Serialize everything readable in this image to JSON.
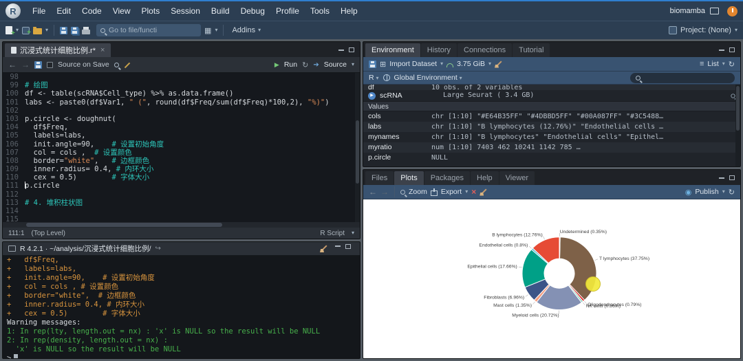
{
  "menubar": {
    "menus": [
      "File",
      "Edit",
      "Code",
      "View",
      "Plots",
      "Session",
      "Build",
      "Debug",
      "Profile",
      "Tools",
      "Help"
    ],
    "user": "biomamba",
    "project_label": "Project: (None)"
  },
  "toolbar": {
    "goto_placeholder": "Go to file/functi",
    "addins_label": "Addins"
  },
  "source": {
    "tab_title": "沉浸式统计细胞比例.r*",
    "source_on_save": "Source on Save",
    "run_label": "Run",
    "source_label": "Source",
    "status_position": "111:1",
    "status_scope": "(Top Level)",
    "status_type": "R Script",
    "cursor_line": 111,
    "code_lines": [
      {
        "n": 98,
        "seg": []
      },
      {
        "n": 99,
        "seg": [
          [
            "com",
            "# 绘图"
          ]
        ]
      },
      {
        "n": 100,
        "seg": [
          [
            "def",
            "df <- table(scRNA$Cell_type) %>% as.data.frame()"
          ]
        ]
      },
      {
        "n": 101,
        "seg": [
          [
            "def",
            "labs <- paste0(df$Var1, "
          ],
          [
            "str",
            "\" (\""
          ],
          [
            "def",
            ", round(df$Freq/sum(df$Freq)*100,2), "
          ],
          [
            "str",
            "\"%)\""
          ],
          [
            "def",
            ")"
          ]
        ]
      },
      {
        "n": 102,
        "seg": []
      },
      {
        "n": 103,
        "seg": [
          [
            "def",
            "p.circle <- doughnut("
          ]
        ]
      },
      {
        "n": 104,
        "seg": [
          [
            "def",
            "  df$Freq,"
          ]
        ]
      },
      {
        "n": 105,
        "seg": [
          [
            "def",
            "  labels=labs,"
          ]
        ]
      },
      {
        "n": 106,
        "seg": [
          [
            "def",
            "  init.angle=90,    "
          ],
          [
            "com",
            "# 设置初始角度"
          ]
        ]
      },
      {
        "n": 107,
        "seg": [
          [
            "def",
            "  col = cols ,  "
          ],
          [
            "com",
            "# 设置颜色"
          ]
        ]
      },
      {
        "n": 108,
        "seg": [
          [
            "def",
            "  border="
          ],
          [
            "str",
            "\"white\""
          ],
          [
            "def",
            ",   "
          ],
          [
            "com",
            "# 边框颜色"
          ]
        ]
      },
      {
        "n": 109,
        "seg": [
          [
            "def",
            "  inner.radius= 0.4, "
          ],
          [
            "com",
            "# 内环大小"
          ]
        ]
      },
      {
        "n": 110,
        "seg": [
          [
            "def",
            "  cex = 0.5)        "
          ],
          [
            "com",
            "# 字体大小"
          ]
        ]
      },
      {
        "n": 111,
        "seg": [
          [
            "def",
            "p.circle"
          ]
        ]
      },
      {
        "n": 112,
        "seg": []
      },
      {
        "n": 113,
        "seg": [
          [
            "com",
            "# 4. 堆积柱状图"
          ]
        ]
      },
      {
        "n": 114,
        "seg": []
      },
      {
        "n": 115,
        "seg": []
      }
    ]
  },
  "console": {
    "title": "R 4.2.1 · ~/analysis/沉浸式统计细胞比例/",
    "lines": [
      {
        "text": "+   df$Freq,",
        "type": "input"
      },
      {
        "text": "+   labels=labs,",
        "type": "input"
      },
      {
        "text": "+   init.angle=90,    # 设置初始角度",
        "type": "input"
      },
      {
        "text": "+   col = cols , # 设置颜色",
        "type": "input"
      },
      {
        "text": "+   border=\"white\",  # 边框颜色",
        "type": "input"
      },
      {
        "text": "+   inner.radius= 0.4, # 内环大小",
        "type": "input"
      },
      {
        "text": "+   cex = 0.5)        # 字体大小",
        "type": "input"
      },
      {
        "text": "Warning messages:",
        "type": "plain"
      },
      {
        "text": "1: In rep(lty, length.out = nx) : 'x' is NULL so the result will be NULL",
        "type": "warning"
      },
      {
        "text": "2: In rep(density, length.out = nx) :",
        "type": "warning"
      },
      {
        "text": "  'x' is NULL so the result will be NULL",
        "type": "warning"
      },
      {
        "text": ">",
        "type": "prompt"
      }
    ]
  },
  "environment": {
    "tabs": [
      "Environment",
      "History",
      "Connections",
      "Tutorial"
    ],
    "active_tab": "Environment",
    "toolbar": {
      "import_label": "Import Dataset",
      "memory": "3.75 GiB",
      "list_label": "List"
    },
    "scope": {
      "lang": "R",
      "label": "Global Environment"
    },
    "partial_row": {
      "name": "df",
      "value": "10 obs. of 2 variables"
    },
    "data_rows": [
      {
        "name": "scRNA",
        "value": "Large Seurat ( 3.4 GB)"
      }
    ],
    "section_values": "Values",
    "value_rows": [
      {
        "name": "cols",
        "value": "chr [1:10] \"#E64B35FF\" \"#4DBBD5FF\" \"#00A087FF\" \"#3C5488…"
      },
      {
        "name": "labs",
        "value": "chr [1:10] \"B lymphocytes (12.76%)\" \"Endothelial cells …"
      },
      {
        "name": "mynames",
        "value": "chr [1:10] \"B lymphocytes\" \"Endothelial cells\" \"Epithel…"
      },
      {
        "name": "myratio",
        "value": "num [1:10] 7403 462 10241 1142 785 …"
      },
      {
        "name": "p.circle",
        "value": "NULL"
      }
    ]
  },
  "plots": {
    "tabs": [
      "Files",
      "Plots",
      "Packages",
      "Help",
      "Viewer"
    ],
    "active_tab": "Plots",
    "zoom_label": "Zoom",
    "export_label": "Export",
    "publish_label": "Publish",
    "highlight_color": "#f2e93c"
  },
  "chart_data": {
    "type": "pie",
    "subtype": "donut",
    "inner_radius_ratio": 0.4,
    "start_angle": 90,
    "direction": "counterclockwise",
    "labels": [
      "B lymphocytes",
      "Endothelial cells",
      "Epithelial cells",
      "Fibroblasts",
      "Mast cells",
      "Myeloid cells",
      "NK cells",
      "Oligodendrocytes",
      "T lymphocytes",
      "Undetermined"
    ],
    "values_percent": [
      12.76,
      0.8,
      17.66,
      6.96,
      1.35,
      20.72,
      0.86,
      0.79,
      37.75,
      0.35
    ],
    "display_labels": [
      "B lymphocytes (12.76%)",
      "Endothelial cells (0.8%)",
      "Epithelial cells (17.66%)",
      "Fibroblasts (6.96%)",
      "Mast cells (1.35%)",
      "Myeloid cells (20.72%)",
      "NK cells (0.86%)",
      "Oligodendrocytes (0.79%)",
      "T lymphocytes (37.75%)",
      "Undetermined (0.35%)"
    ],
    "colors": [
      "#E64B35",
      "#4DBBD5",
      "#00A087",
      "#3C5488",
      "#F39B7F",
      "#8491B4",
      "#91D1C2",
      "#DC0000",
      "#7E6148",
      "#B09C85"
    ],
    "title": "",
    "legend": "none"
  }
}
